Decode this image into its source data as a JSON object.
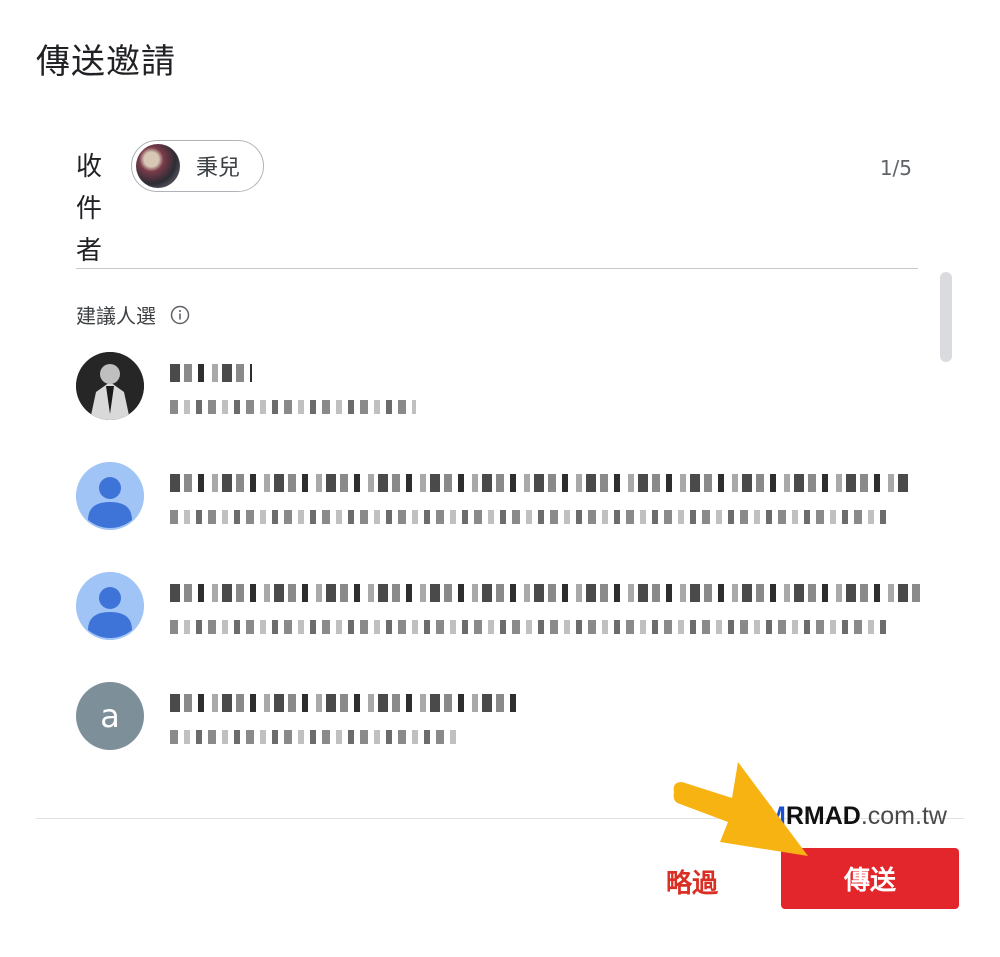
{
  "dialog": {
    "title": "傳送邀請"
  },
  "recipients": {
    "label": "收件者",
    "chip_name": "秉兒",
    "count": "1/5"
  },
  "suggestions": {
    "heading": "建議人選",
    "info_icon": "info-icon",
    "contacts": [
      {
        "avatar": "photo",
        "letter": ""
      },
      {
        "avatar": "default-person",
        "letter": ""
      },
      {
        "avatar": "default-person",
        "letter": ""
      },
      {
        "avatar": "letter",
        "letter": "a"
      }
    ]
  },
  "watermark": {
    "prefix": "M",
    "brand": "RMAD",
    "suffix": ".com.tw"
  },
  "actions": {
    "skip_label": "略過",
    "send_label": "傳送"
  },
  "colors": {
    "accent_red": "#e3262b",
    "skip_red": "#d93025",
    "arrow_yellow": "#f6b312"
  }
}
